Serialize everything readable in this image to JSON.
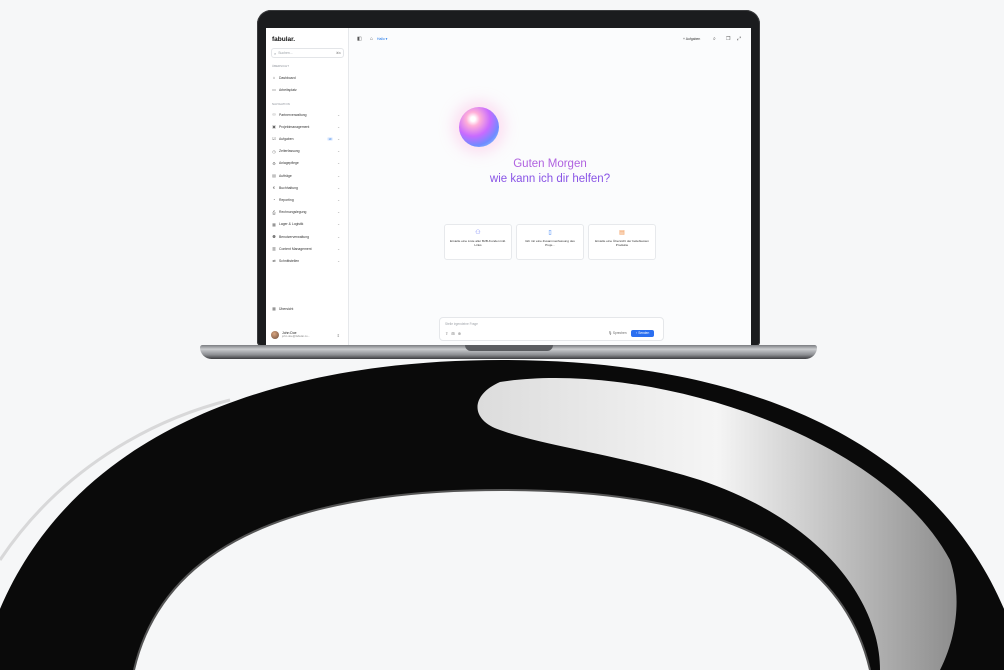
{
  "app": {
    "logo": "fabular."
  },
  "sidebar": {
    "search_placeholder": "Suchen...",
    "search_shortcut": "⌘K",
    "section_overview": "ÜBERSICHT",
    "overview_items": [
      {
        "label": "Dashboard",
        "icon": "home-icon"
      },
      {
        "label": "Arbeitsplatz",
        "icon": "desk-icon"
      }
    ],
    "section_nav": "NAVIGATION",
    "nav_items": [
      {
        "label": "Partnerverwaltung"
      },
      {
        "label": "Projektmanagement"
      },
      {
        "label": "Aufgaben",
        "badge": "10"
      },
      {
        "label": "Zeiterfassung"
      },
      {
        "label": "Anlagepflege"
      },
      {
        "label": "Aufträge"
      },
      {
        "label": "Buchhaltung"
      },
      {
        "label": "Reporting"
      },
      {
        "label": "Rechnungslegung"
      },
      {
        "label": "Lager & Logistik"
      },
      {
        "label": "Benutzerverwaltung"
      },
      {
        "label": "Content Management"
      },
      {
        "label": "Schnittstellen"
      }
    ],
    "bottom_item": "Übersicht",
    "user": {
      "name": "John Doe",
      "email": "john.doe@fabular.co..."
    }
  },
  "topbar": {
    "breadcrumb": "Hallo ▾",
    "tasks_label": "+ Aufgaben"
  },
  "main": {
    "greeting_line1": "Guten Morgen",
    "greeting_line2": "wie kann ich dir helfen?",
    "suggestions": [
      {
        "text": "Erstelle eine Liste aller B2B-Kunden inkl. Links",
        "icon": "users-icon",
        "color": "#6f7cf5"
      },
      {
        "text": "Gib mir eine Zusammenfassung des Proje...",
        "icon": "document-icon",
        "color": "#3b82f6"
      },
      {
        "text": "Erstelle eine Übersicht der beliebtesten Produkte",
        "icon": "chart-icon",
        "color": "#f08a3c"
      }
    ],
    "input_placeholder": "Stelle irgendeine Frage",
    "voice_label": "🎙 Sprechen",
    "send_label": "↑ Senden"
  },
  "colors": {
    "accent": "#2b6ff0",
    "greeting_purple": "#8a55e6"
  }
}
